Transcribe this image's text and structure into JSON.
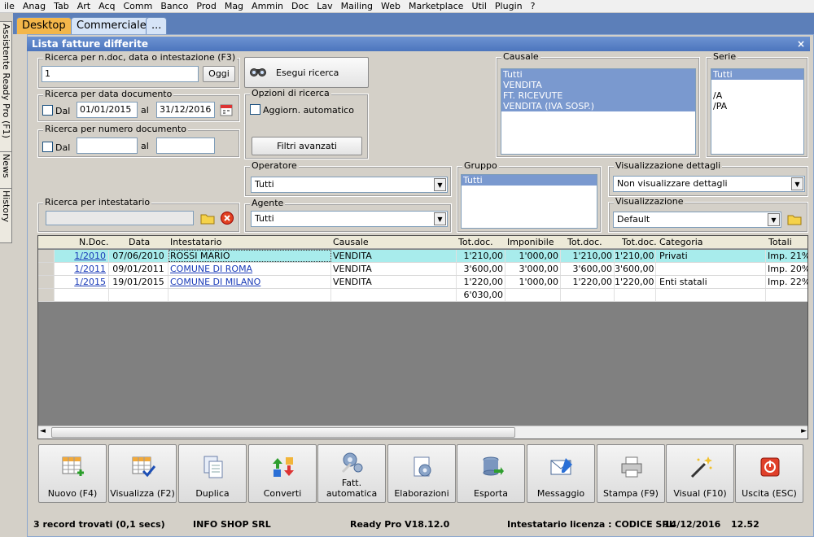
{
  "menu": [
    "ile",
    "Anag",
    "Tab",
    "Art",
    "Acq",
    "Comm",
    "Banco",
    "Prod",
    "Mag",
    "Ammin",
    "Doc",
    "Lav",
    "Mailing",
    "Web",
    "Marketplace",
    "Util",
    "Plugin",
    "?"
  ],
  "side_tabs": [
    "Assistente Ready Pro (F1)",
    "News",
    "History"
  ],
  "tabs": [
    "Desktop",
    "Commerciale",
    "..."
  ],
  "window": {
    "title": "Lista fatture differite",
    "close": "×"
  },
  "search_ndoc": {
    "label": "Ricerca per n.doc, data o intestazione (F3)",
    "value": "1",
    "today_btn": "Oggi"
  },
  "search_btn": "Esegui ricerca",
  "search_date": {
    "label": "Ricerca per data documento",
    "dal": "Dal",
    "from": "01/01/2015",
    "al": "al",
    "to": "31/12/2016"
  },
  "search_num": {
    "label": "Ricerca per numero documento",
    "dal": "Dal",
    "al": "al"
  },
  "options": {
    "label": "Opzioni di ricerca",
    "auto": "Aggiorn. automatico",
    "filter_btn": "Filtri avanzati"
  },
  "causale": {
    "label": "Causale",
    "items": [
      "Tutti",
      "VENDITA",
      "FT. RICEVUTE",
      "VENDITA (IVA SOSP.)"
    ]
  },
  "serie": {
    "label": "Serie",
    "items": [
      "Tutti",
      "",
      "/A",
      "/PA"
    ]
  },
  "operatore": {
    "label": "Operatore",
    "value": "Tutti"
  },
  "agente": {
    "label": "Agente",
    "value": "Tutti"
  },
  "gruppo": {
    "label": "Gruppo",
    "items": [
      "Tutti"
    ]
  },
  "intestatario": {
    "label": "Ricerca per intestatario"
  },
  "vis_dettagli": {
    "label": "Visualizzazione dettagli",
    "value": "Non visualizzare dettagli"
  },
  "visualizzazione": {
    "label": "Visualizzazione",
    "value": "Default"
  },
  "grid": {
    "headers": [
      "N.Doc.",
      "Data",
      "Intestatario",
      "Causale",
      "Tot.doc.",
      "Imponibile",
      "Tot.doc.",
      "Tot.doc.",
      "Categoria",
      "Totali"
    ],
    "rows": [
      [
        "1/2010",
        "07/06/2010",
        "ROSSI MARIO",
        "VENDITA",
        "1'210,00",
        "1'000,00",
        "1'210,00",
        "1'210,00",
        "Privati",
        "Imp. 21%"
      ],
      [
        "1/2011",
        "09/01/2011",
        "COMUNE DI ROMA",
        "VENDITA",
        "3'600,00",
        "3'000,00",
        "3'600,00",
        "3'600,00",
        "",
        "Imp. 20%"
      ],
      [
        "1/2015",
        "19/01/2015",
        "COMUNE DI MILANO",
        "VENDITA",
        "1'220,00",
        "1'000,00",
        "1'220,00",
        "1'220,00",
        "Enti statali",
        "Imp. 22%"
      ]
    ],
    "total": "6'030,00"
  },
  "toolbar": [
    {
      "label": "Nuovo (F4)",
      "icon": "new-document-icon"
    },
    {
      "label": "Visualizza (F2)",
      "icon": "view-check-icon"
    },
    {
      "label": "Duplica",
      "icon": "duplicate-icon"
    },
    {
      "label": "Converti",
      "icon": "convert-icon"
    },
    {
      "label": "Fatt.\nautomatica",
      "icon": "auto-invoice-icon"
    },
    {
      "label": "Elaborazioni",
      "icon": "process-icon"
    },
    {
      "label": "Esporta",
      "icon": "export-icon"
    },
    {
      "label": "Messaggio",
      "icon": "message-icon"
    },
    {
      "label": "Stampa (F9)",
      "icon": "printer-icon"
    },
    {
      "label": "Visual (F10)",
      "icon": "magic-wand-icon"
    },
    {
      "label": "Uscita (ESC)",
      "icon": "exit-icon"
    }
  ],
  "status": {
    "records": "3 record trovati (0,1 secs)",
    "company": "INFO SHOP SRL",
    "version": "Ready Pro V18.12.0",
    "license": "Intestatario licenza : CODICE SRL",
    "date": "14/12/2016",
    "time": "12.52"
  },
  "colors": {
    "tab_active": "#f3b64a",
    "tab_inactive": "#d6e4f7",
    "title": "#5a82c5",
    "selection": "#7a99cf",
    "row_highlight": "#a8ecec",
    "link": "#1a3bb8"
  }
}
